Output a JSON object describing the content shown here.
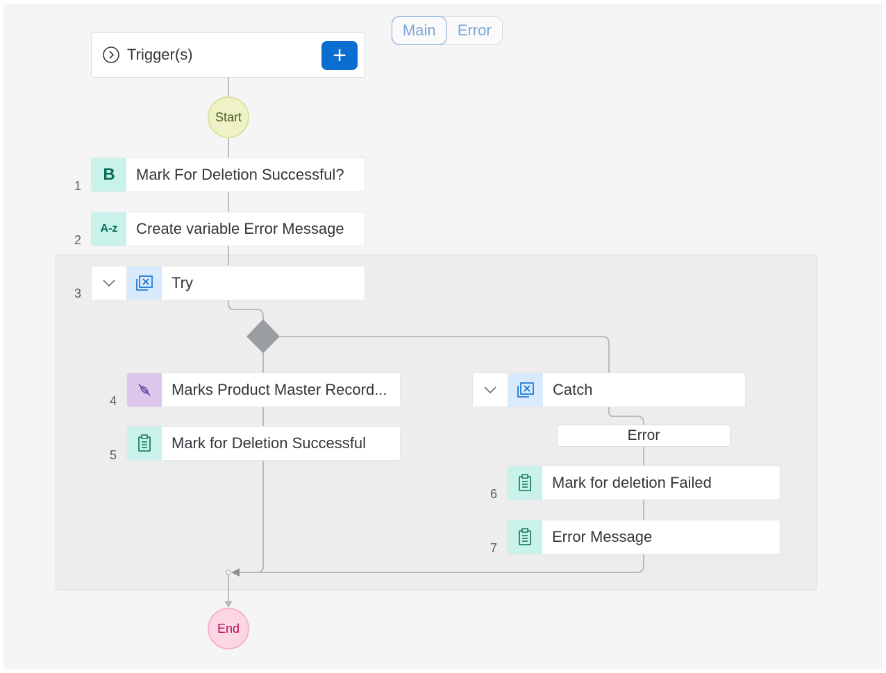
{
  "toggle": {
    "main": "Main",
    "error": "Error"
  },
  "trigger": {
    "label": "Trigger(s)",
    "add": "+"
  },
  "start": "Start",
  "end": "End",
  "steps": [
    {
      "num": "1",
      "icon_text": "B",
      "label": "Mark For Deletion Successful?"
    },
    {
      "num": "2",
      "icon_text": "A-z",
      "label": "Create variable Error Message"
    },
    {
      "num": "3",
      "label": "Try"
    },
    {
      "num": "4",
      "label": "Marks Product Master Record..."
    },
    {
      "num": "5",
      "label": "Mark for Deletion Successful"
    },
    {
      "label": "Catch"
    },
    {
      "num": "6",
      "label": "Mark for deletion Failed"
    },
    {
      "num": "7",
      "label": "Error Message"
    }
  ],
  "catch_error_label": "Error",
  "colors": {
    "accent": "#0a6ed1",
    "start": "#eef2c6",
    "end": "#fcd6e4",
    "teal": "#c9f3ea",
    "purple": "#dcc6ec"
  }
}
